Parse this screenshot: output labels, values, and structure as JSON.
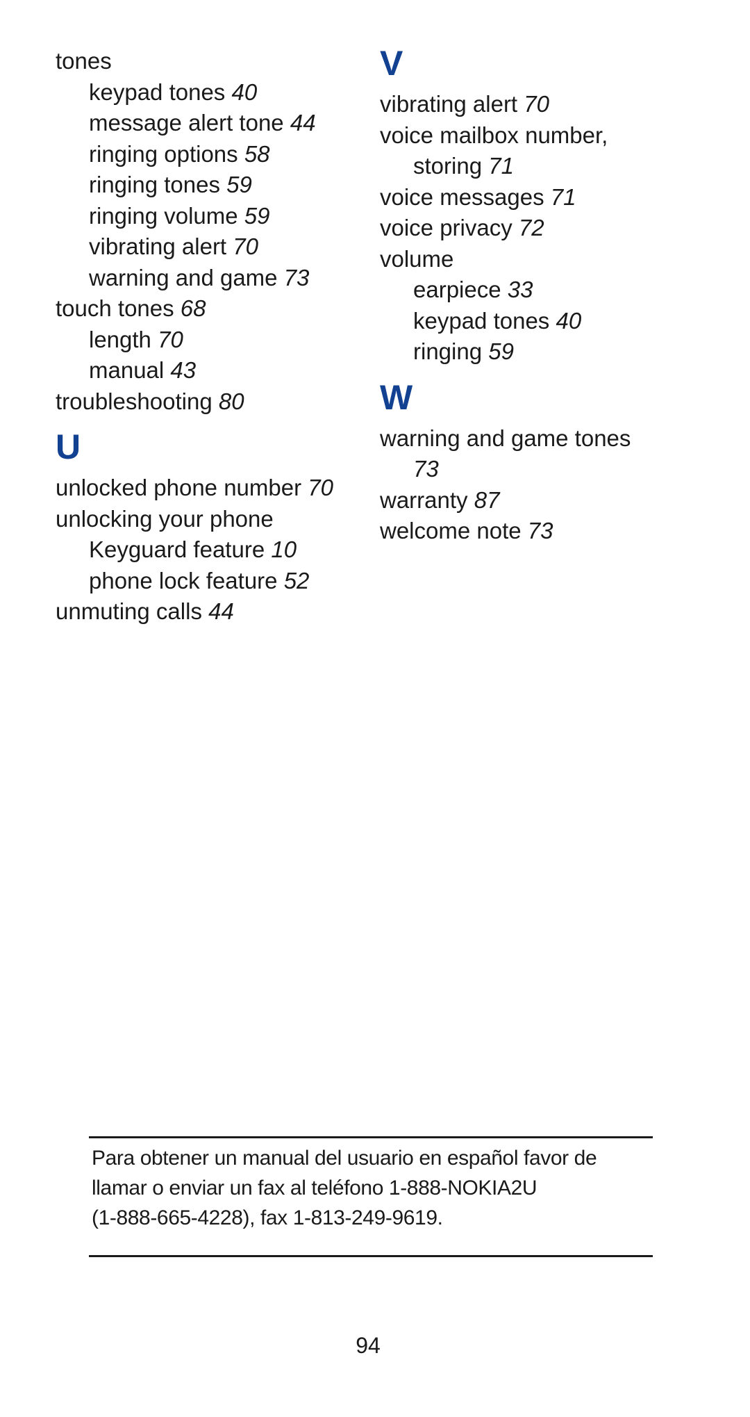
{
  "index": {
    "left_column": [
      {
        "type": "entry",
        "level": 0,
        "term": "tones",
        "page": ""
      },
      {
        "type": "entry",
        "level": 1,
        "term": "keypad tones",
        "page": "40"
      },
      {
        "type": "entry",
        "level": 1,
        "term": "message alert tone",
        "page": "44"
      },
      {
        "type": "entry",
        "level": 1,
        "term": "ringing options",
        "page": "58"
      },
      {
        "type": "entry",
        "level": 1,
        "term": "ringing tones",
        "page": "59"
      },
      {
        "type": "entry",
        "level": 1,
        "term": "ringing volume",
        "page": "59"
      },
      {
        "type": "entry",
        "level": 1,
        "term": "vibrating alert",
        "page": "70"
      },
      {
        "type": "entry",
        "level": 1,
        "term": "warning and game",
        "page": "73"
      },
      {
        "type": "entry",
        "level": 0,
        "term": "touch tones",
        "page": "68"
      },
      {
        "type": "entry",
        "level": 1,
        "term": "length",
        "page": "70"
      },
      {
        "type": "entry",
        "level": 1,
        "term": "manual",
        "page": "43"
      },
      {
        "type": "entry",
        "level": 0,
        "term": "troubleshooting",
        "page": "80"
      },
      {
        "type": "letter",
        "label": "U"
      },
      {
        "type": "entry",
        "level": 0,
        "term": "unlocked phone number",
        "page": "70"
      },
      {
        "type": "entry",
        "level": 0,
        "term": "unlocking your phone",
        "page": ""
      },
      {
        "type": "entry",
        "level": 1,
        "term": "Keyguard feature",
        "page": "10"
      },
      {
        "type": "entry",
        "level": 1,
        "term": "phone lock feature",
        "page": "52"
      },
      {
        "type": "entry",
        "level": 0,
        "term": "unmuting calls",
        "page": "44"
      }
    ],
    "right_column": [
      {
        "type": "letter",
        "label": "V"
      },
      {
        "type": "entry",
        "level": 0,
        "term": "vibrating alert",
        "page": "70"
      },
      {
        "type": "entry",
        "level": 0,
        "term": "voice mailbox number,",
        "page": ""
      },
      {
        "type": "entry",
        "level": 1,
        "term": "storing",
        "page": "71"
      },
      {
        "type": "entry",
        "level": 0,
        "term": "voice messages",
        "page": "71"
      },
      {
        "type": "entry",
        "level": 0,
        "term": "voice privacy",
        "page": "72"
      },
      {
        "type": "entry",
        "level": 0,
        "term": "volume",
        "page": ""
      },
      {
        "type": "entry",
        "level": 1,
        "term": "earpiece",
        "page": "33"
      },
      {
        "type": "entry",
        "level": 1,
        "term": "keypad tones",
        "page": "40"
      },
      {
        "type": "entry",
        "level": 1,
        "term": "ringing",
        "page": "59"
      },
      {
        "type": "letter",
        "label": "W"
      },
      {
        "type": "entry",
        "level": 0,
        "term": "warning and game tones",
        "page": ""
      },
      {
        "type": "entry",
        "level": 1,
        "term": "",
        "page": "73"
      },
      {
        "type": "entry",
        "level": 0,
        "term": "warranty",
        "page": "87"
      },
      {
        "type": "entry",
        "level": 0,
        "term": "welcome note",
        "page": "73"
      }
    ]
  },
  "spanish_note": {
    "lines": [
      "Para obtener un manual del usuario en español favor de",
      "llamar o enviar un fax al teléfono 1-888-NOKIA2U",
      "(1-888-665-4228), fax 1-813-249-9619."
    ]
  },
  "footer": {
    "page_number": "94"
  },
  "colors": {
    "section_letter": "#124191",
    "text": "#1a1a1a"
  }
}
